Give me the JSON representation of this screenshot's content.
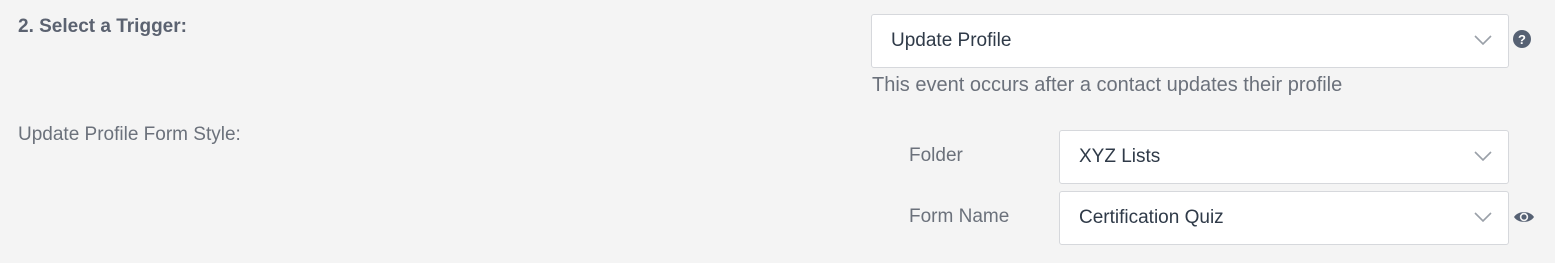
{
  "trigger_section": {
    "title": "2. Select a Trigger:",
    "selected_trigger": "Update Profile",
    "description": "This event occurs after a contact updates their profile",
    "help_icon": "question-circle-icon",
    "help_glyph": "?"
  },
  "form_style": {
    "label": "Update Profile Form Style:",
    "folder": {
      "label": "Folder",
      "value": "XYZ Lists"
    },
    "form_name": {
      "label": "Form Name",
      "value": "Certification Quiz",
      "preview_icon": "eye-icon"
    }
  },
  "colors": {
    "background": "#f4f4f4",
    "text_dark": "#2f3a48",
    "text_muted": "#6b717b",
    "icon": "#566173",
    "border": "#d6d8dc"
  }
}
